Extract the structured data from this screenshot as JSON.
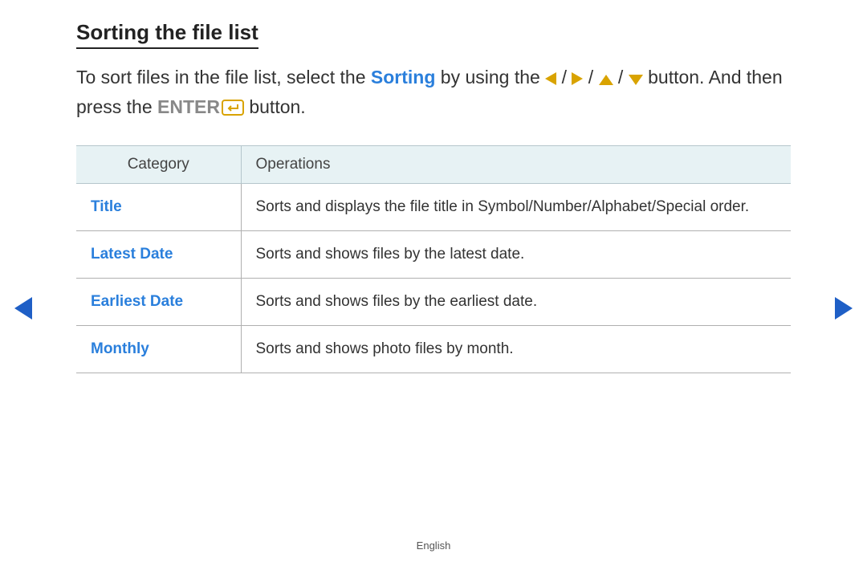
{
  "heading": "Sorting the file list",
  "intro": {
    "part1": "To sort files in the file list, select the ",
    "sorting": "Sorting",
    "part2": " by using the ",
    "sep": " / ",
    "part3": " button. And then press the ",
    "enter": "ENTER",
    "part4": " button."
  },
  "table": {
    "headers": {
      "category": "Category",
      "operations": "Operations"
    },
    "rows": [
      {
        "category": "Title",
        "operation": "Sorts and displays the file title in Symbol/Number/Alphabet/Special order."
      },
      {
        "category": "Latest Date",
        "operation": "Sorts and shows files by the latest date."
      },
      {
        "category": "Earliest Date",
        "operation": "Sorts and shows files by the earliest date."
      },
      {
        "category": "Monthly",
        "operation": "Sorts and shows photo files by month."
      }
    ]
  },
  "footer": {
    "language": "English"
  }
}
